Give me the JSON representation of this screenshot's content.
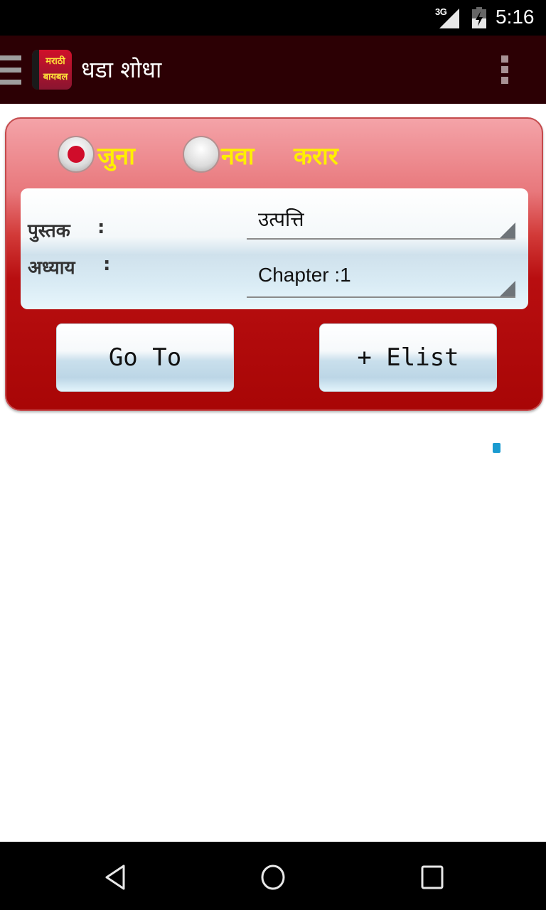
{
  "status_bar": {
    "network": "3G",
    "time": "5:16",
    "icons": [
      "signal-icon",
      "battery-charging-icon"
    ]
  },
  "app_bar": {
    "menu_icon": "hamburger-icon",
    "app_logo_line1": "मराठी",
    "app_logo_line2": "बायबल",
    "title": "धडा शोधा",
    "overflow_icon": "more-vert-icon"
  },
  "testament": {
    "options": [
      {
        "label": "जुना",
        "selected": true
      },
      {
        "label": "नवा",
        "selected": false
      }
    ],
    "suffix": "करार"
  },
  "form": {
    "book_label": "पुस्तक",
    "book_value": "उत्पत्ति",
    "chapter_label": "अध्याय",
    "chapter_value": "Chapter :1",
    "colon": ":"
  },
  "buttons": {
    "goto": "Go To",
    "elist": "+ Elist"
  },
  "colors": {
    "app_bar": "#2c0004",
    "card_red": "#b80e10",
    "radio_label": "#ffef00",
    "accent_blue": "#1a9bd0"
  },
  "nav_bar": {
    "icons": [
      "back-icon",
      "home-icon",
      "recents-icon"
    ]
  }
}
